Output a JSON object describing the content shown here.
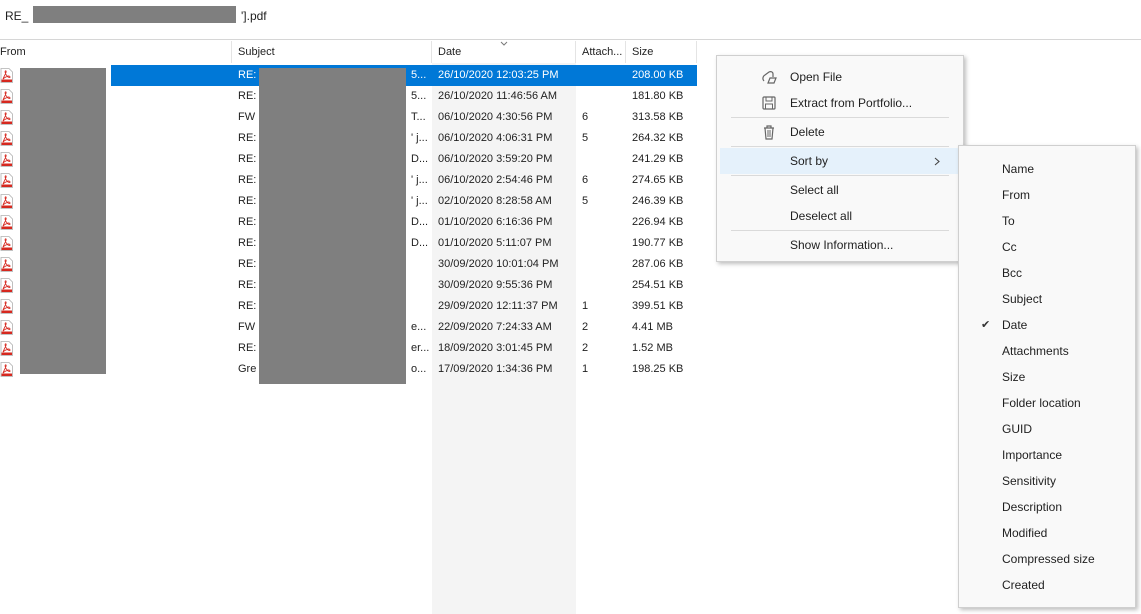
{
  "window": {
    "title_prefix": "RE_",
    "title_suffix": "'].pdf"
  },
  "columns": {
    "from": "From",
    "subject": "Subject",
    "date": "Date",
    "attachments": "Attach...",
    "size": "Size"
  },
  "rows": [
    {
      "subject": "RE:",
      "subject_tail": "5...",
      "date": "26/10/2020 12:03:25 PM",
      "attachments": "",
      "size": "208.00 KB",
      "selected": true
    },
    {
      "subject": "RE:",
      "subject_tail": "5...",
      "date": "26/10/2020 11:46:56 AM",
      "attachments": "",
      "size": "181.80 KB",
      "selected": false
    },
    {
      "subject": "FW",
      "subject_tail": "T...",
      "date": "06/10/2020 4:30:56 PM",
      "attachments": "6",
      "size": "313.58 KB",
      "selected": false
    },
    {
      "subject": "RE:",
      "subject_tail": "' j...",
      "date": "06/10/2020 4:06:31 PM",
      "attachments": "5",
      "size": "264.32 KB",
      "selected": false
    },
    {
      "subject": "RE:",
      "subject_tail": "D...",
      "date": "06/10/2020 3:59:20 PM",
      "attachments": "",
      "size": "241.29 KB",
      "selected": false
    },
    {
      "subject": "RE:",
      "subject_tail": "' j...",
      "date": "06/10/2020 2:54:46 PM",
      "attachments": "6",
      "size": "274.65 KB",
      "selected": false
    },
    {
      "subject": "RE:",
      "subject_tail": "' j...",
      "date": "02/10/2020 8:28:58 AM",
      "attachments": "5",
      "size": "246.39 KB",
      "selected": false
    },
    {
      "subject": "RE:",
      "subject_tail": "D...",
      "date": "01/10/2020 6:16:36 PM",
      "attachments": "",
      "size": "226.94 KB",
      "selected": false
    },
    {
      "subject": "RE:",
      "subject_tail": "D...",
      "date": "01/10/2020 5:11:07 PM",
      "attachments": "",
      "size": "190.77 KB",
      "selected": false
    },
    {
      "subject": "RE:",
      "subject_tail": "",
      "date": "30/09/2020 10:01:04 PM",
      "attachments": "",
      "size": "287.06 KB",
      "selected": false
    },
    {
      "subject": "RE:",
      "subject_tail": "",
      "date": "30/09/2020 9:55:36 PM",
      "attachments": "",
      "size": "254.51 KB",
      "selected": false
    },
    {
      "subject": "RE:",
      "subject_tail": "",
      "date": "29/09/2020 12:11:37 PM",
      "attachments": "1",
      "size": "399.51 KB",
      "selected": false
    },
    {
      "subject": "FW",
      "subject_tail": "e...",
      "date": "22/09/2020 7:24:33 AM",
      "attachments": "2",
      "size": "4.41 MB",
      "selected": false
    },
    {
      "subject": "RE:",
      "subject_tail": "er...",
      "date": "18/09/2020 3:01:45 PM",
      "attachments": "2",
      "size": "1.52 MB",
      "selected": false
    },
    {
      "subject": "Gre",
      "subject_tail": "o...",
      "date": "17/09/2020 1:34:36 PM",
      "attachments": "1",
      "size": "198.25 KB",
      "selected": false
    }
  ],
  "context_menu": {
    "open_file": "Open File",
    "extract": "Extract from Portfolio...",
    "delete": "Delete",
    "sort_by": "Sort by",
    "select_all": "Select all",
    "deselect_all": "Deselect all",
    "show_information": "Show Information..."
  },
  "sort_submenu": {
    "items": [
      "Name",
      "From",
      "To",
      "Cc",
      "Bcc",
      "Subject",
      "Date",
      "Attachments",
      "Size",
      "Folder location",
      "GUID",
      "Importance",
      "Sensitivity",
      "Description",
      "Modified",
      "Compressed size",
      "Created"
    ],
    "checked": "Date"
  },
  "colors": {
    "selection": "#0078d7",
    "hover": "#e5f1fb",
    "redaction": "#7f7f7f",
    "pdf_red": "#d6281f"
  },
  "icons": {
    "file": "pdf-file-icon",
    "open": "open-file-icon",
    "extract": "save-disk-icon",
    "delete": "trash-icon",
    "submenu": "chevron-right-icon",
    "check": "checkmark-icon",
    "sort": "sort-down-icon"
  }
}
